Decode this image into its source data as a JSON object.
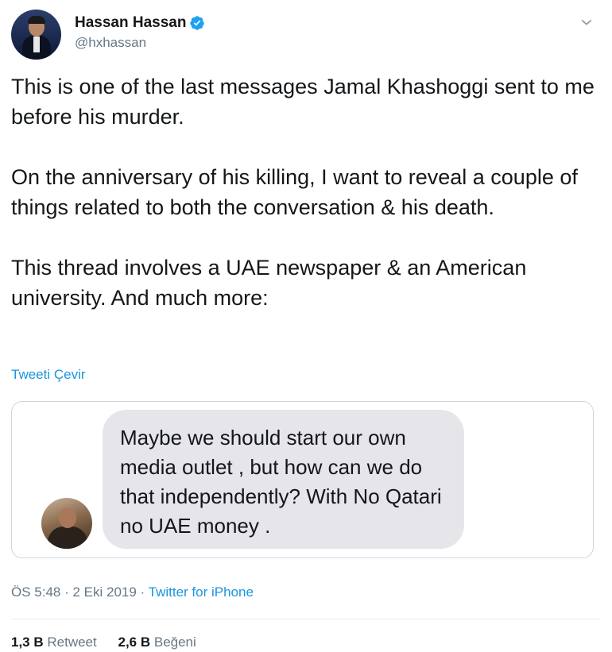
{
  "author": {
    "display_name": "Hassan Hassan",
    "handle": "@hxhassan",
    "verified": true
  },
  "tweet": {
    "paragraphs": [
      "This is one of the last messages Jamal Khashoggi sent to me before his murder.",
      "On the anniversary of his killing, I want to reveal a couple of things related to both the conversation & his death.",
      "This thread involves a UAE newspaper & an American university. And much more:"
    ],
    "translate_label": "Tweeti Çevir"
  },
  "media": {
    "message_text": "Maybe we should start our own media outlet , but how can we do that independently? With No Qatari no UAE money ."
  },
  "meta": {
    "time": "ÖS 5:48",
    "separator": " · ",
    "date": "2 Eki 2019",
    "source": "Twitter for iPhone"
  },
  "stats": {
    "retweets_count": "1,3 B",
    "retweets_label": "Retweet",
    "likes_count": "2,6 B",
    "likes_label": "Beğeni"
  },
  "colors": {
    "link": "#1b95e0",
    "secondary_text": "#657786",
    "bubble": "#e5e5ea",
    "verified": "#1da1f2"
  },
  "icons": {
    "verified": "verified-badge-icon",
    "menu": "chevron-down-icon"
  }
}
